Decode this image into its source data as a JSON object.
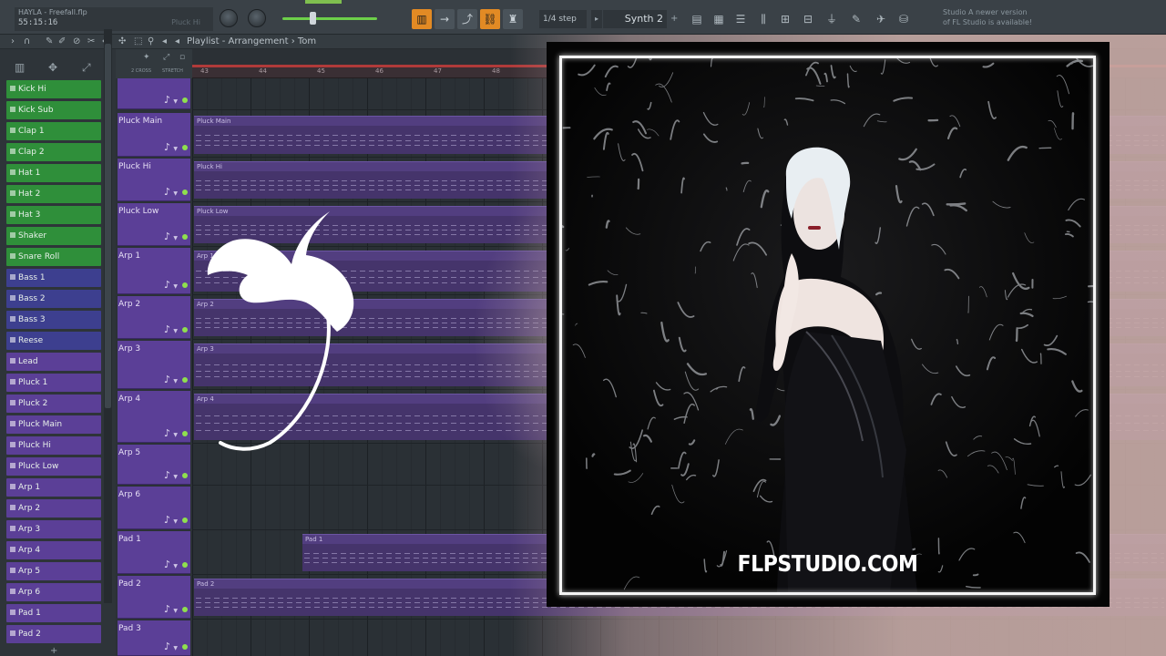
{
  "toolbar": {
    "song_title": "HAYLA - Freefall.flp",
    "song_time": "55:15:16",
    "hint": "Pluck Hi",
    "step_label": "1/4 step",
    "pattern_name": "Synth 2",
    "pattern_add": "+",
    "news_line1": "Studio   A newer version",
    "news_line2": "of FL Studio is available!"
  },
  "playlist": {
    "title": "Playlist - Arrangement",
    "separator": "›",
    "breadcrumb": "Tom",
    "crossfade_label": "2 CROSS",
    "stretch_label": "STRETCH",
    "bars": [
      "43",
      "44",
      "45",
      "46",
      "47",
      "48"
    ]
  },
  "picker": {
    "items": [
      {
        "label": "Kick Hi",
        "color": "#2f8f3a"
      },
      {
        "label": "Kick Sub",
        "color": "#2f8f3a"
      },
      {
        "label": "Clap 1",
        "color": "#2f8f3a"
      },
      {
        "label": "Clap 2",
        "color": "#2f8f3a"
      },
      {
        "label": "Hat 1",
        "color": "#2f8f3a"
      },
      {
        "label": "Hat 2",
        "color": "#2f8f3a"
      },
      {
        "label": "Hat 3",
        "color": "#2f8f3a"
      },
      {
        "label": "Shaker",
        "color": "#2f8f3a"
      },
      {
        "label": "Snare Roll",
        "color": "#2f8f3a"
      },
      {
        "label": "Bass 1",
        "color": "#3d3f8f"
      },
      {
        "label": "Bass 2",
        "color": "#3d3f8f"
      },
      {
        "label": "Bass 3",
        "color": "#3d3f8f"
      },
      {
        "label": "Reese",
        "color": "#3d3f8f"
      },
      {
        "label": "Lead",
        "color": "#5b3f97"
      },
      {
        "label": "Pluck 1",
        "color": "#5b3f97"
      },
      {
        "label": "Pluck 2",
        "color": "#5b3f97"
      },
      {
        "label": "Pluck Main",
        "color": "#5b3f97"
      },
      {
        "label": "Pluck Hi",
        "color": "#5b3f97"
      },
      {
        "label": "Pluck Low",
        "color": "#5b3f97"
      },
      {
        "label": "Arp 1",
        "color": "#5b3f97"
      },
      {
        "label": "Arp 2",
        "color": "#5b3f97"
      },
      {
        "label": "Arp 3",
        "color": "#5b3f97"
      },
      {
        "label": "Arp 4",
        "color": "#5b3f97"
      },
      {
        "label": "Arp 5",
        "color": "#5b3f97"
      },
      {
        "label": "Arp 6",
        "color": "#5b3f97"
      },
      {
        "label": "Pad 1",
        "color": "#5b3f97"
      },
      {
        "label": "Pad 2",
        "color": "#5b3f97"
      }
    ],
    "add_label": "+"
  },
  "tracks": [
    {
      "name": "",
      "clip": ""
    },
    {
      "name": "Pluck Main",
      "clip": "Pluck Main"
    },
    {
      "name": "Pluck Hi",
      "clip": "Pluck Hi"
    },
    {
      "name": "Pluck Low",
      "clip": "Pluck Low"
    },
    {
      "name": "Arp 1",
      "clip": "Arp 1"
    },
    {
      "name": "Arp 2",
      "clip": "Arp 2"
    },
    {
      "name": "Arp 3",
      "clip": "Arp 3"
    },
    {
      "name": "Arp 4",
      "clip": "Arp 4"
    },
    {
      "name": "Arp 5",
      "clip": ""
    },
    {
      "name": "Arp 6",
      "clip": ""
    },
    {
      "name": "Pad 1",
      "clip": "Pad 1"
    },
    {
      "name": "Pad 2",
      "clip": "Pad 2"
    },
    {
      "name": "Pad 3",
      "clip": ""
    }
  ],
  "cover": {
    "caption": "FLPSTUDIO.COM"
  },
  "colors": {
    "accent_orange": "#e28a24",
    "drum_green": "#2f8f3a",
    "bass_blue": "#3d3f8f",
    "synth_purple": "#5b3f97",
    "led_green": "#8fe04e"
  }
}
